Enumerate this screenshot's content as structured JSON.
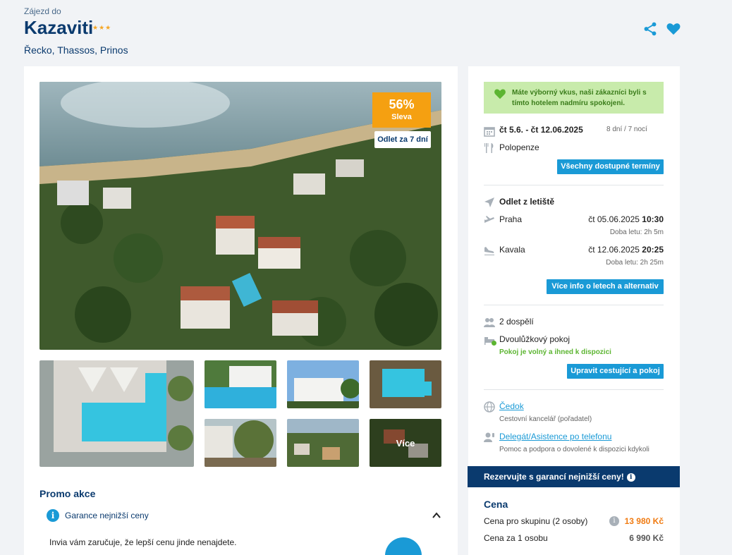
{
  "header": {
    "subtitle": "Zájezd do",
    "title": "Kazaviti",
    "stars": "★★★",
    "location": "Řecko, Thassos, Prinos"
  },
  "gallery": {
    "discount_pct": "56%",
    "discount_label": "Sleva",
    "departure_badge": "Odlet za 7 dní",
    "more_label": "Více"
  },
  "promo": {
    "title": "Promo akce",
    "item_label": "Garance nejnižší ceny",
    "text": "Invia vám zaručuje, že lepší cenu jinde nenajdete."
  },
  "sidebar": {
    "note": "Máte výborný vkus, naši zákazníci byli s tímto hotelem nadmíru spokojeni.",
    "dates": "čt 5.6. - čt 12.06.2025",
    "duration": "8 dní / 7 nocí",
    "board": "Polopenze",
    "all_dates_button": "Všechny dostupné termíny",
    "departure_label": "Odlet z letiště",
    "outbound": {
      "city": "Praha",
      "date": "čt 05.06.2025",
      "time": "10:30",
      "duration": "Doba letu: 2h 5m"
    },
    "inbound": {
      "city": "Kavala",
      "date": "čt 12.06.2025",
      "time": "20:25",
      "duration": "Doba letu: 2h 25m"
    },
    "flight_info_button": "Více info o letech a alternativ",
    "travellers": "2 dospělí",
    "room": "Dvoulůžkový pokoj",
    "room_status": "Pokoj je volný a ihned k dispozici",
    "edit_button": "Upravit cestující a pokoj",
    "organizer_link": "Čedok",
    "organizer_desc": "Cestovní kancelář (pořadatel)",
    "delegate_link": "Delegát/Asistence po telefonu",
    "delegate_desc": "Pomoc a podpora o dovolené k dispozici kdykoli",
    "guarantee_bar": "Rezervujte s garancí nejnižší ceny!",
    "price_title": "Cena",
    "group_label": "Cena pro skupinu (2 osoby)",
    "group_price": "13 980 Kč",
    "person_label": "Cena za 1 osobu",
    "person_price": "6 990 Kč"
  },
  "colors": {
    "brand_navy": "#0a3a6e",
    "accent_blue": "#1a9ad6",
    "discount_orange": "#f5a011",
    "success_green": "#5cb531"
  }
}
